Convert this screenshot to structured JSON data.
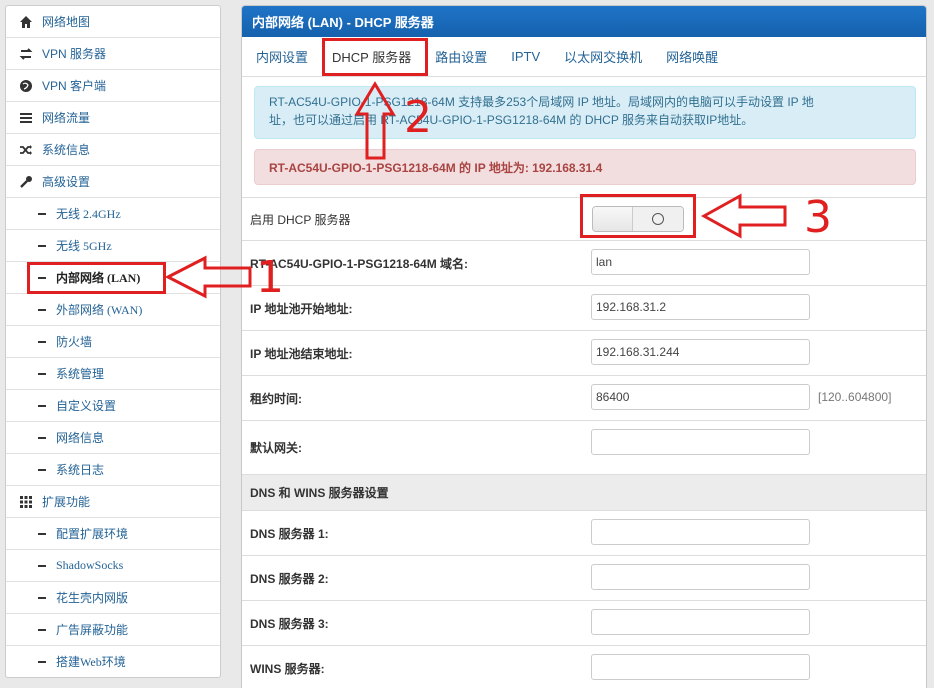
{
  "sidebar": {
    "items": [
      {
        "label": "网络地图",
        "icon": "home-icon",
        "type": "top"
      },
      {
        "label": "VPN 服务器",
        "icon": "exchange-icon",
        "type": "top"
      },
      {
        "label": "VPN 客户端",
        "icon": "globe-icon",
        "type": "top"
      },
      {
        "label": "网络流量",
        "icon": "list-icon",
        "type": "top"
      },
      {
        "label": "系统信息",
        "icon": "random-icon",
        "type": "top"
      },
      {
        "label": "高级设置",
        "icon": "wrench-icon",
        "type": "top"
      },
      {
        "label": "无线 2.4GHz",
        "type": "sub"
      },
      {
        "label": "无线 5GHz",
        "type": "sub"
      },
      {
        "label": "内部网络 (LAN)",
        "type": "sub",
        "active": true
      },
      {
        "label": "外部网络 (WAN)",
        "type": "sub"
      },
      {
        "label": "防火墙",
        "type": "sub"
      },
      {
        "label": "系统管理",
        "type": "sub"
      },
      {
        "label": "自定义设置",
        "type": "sub"
      },
      {
        "label": "网络信息",
        "type": "sub"
      },
      {
        "label": "系统日志",
        "type": "sub"
      },
      {
        "label": "扩展功能",
        "icon": "grid-icon",
        "type": "top"
      },
      {
        "label": "配置扩展环境",
        "type": "sub"
      },
      {
        "label": "ShadowSocks",
        "type": "sub"
      },
      {
        "label": "花生壳内网版",
        "type": "sub"
      },
      {
        "label": "广告屏蔽功能",
        "type": "sub"
      },
      {
        "label": "搭建Web环境",
        "type": "sub"
      }
    ]
  },
  "panel": {
    "title": "内部网络 (LAN) - DHCP 服务器",
    "tabs": [
      "内网设置",
      "DHCP 服务器",
      "路由设置",
      "IPTV",
      "以太网交换机",
      "网络唤醒"
    ],
    "active_tab": 1,
    "info_line1": "RT-AC54U-GPIO-1-PSG1218-64M 支持最多253个局域网 IP 地址。局域网内的电脑可以手动设置 IP 地",
    "info_line2": "址，也可以通过启用 RT-AC54U-GPIO-1-PSG1218-64M 的 DHCP 服务来自动获取IP地址。",
    "danger": "RT-AC54U-GPIO-1-PSG1218-64M 的 IP 地址为: 192.168.31.4"
  },
  "form": {
    "dhcp_enable_label": "启用 DHCP 服务器",
    "dhcp_enabled": false,
    "domain_label": "RT-AC54U-GPIO-1-PSG1218-64M 域名:",
    "domain_value": "lan",
    "pool_start_label": "IP 地址池开始地址:",
    "pool_start_value": "192.168.31.2",
    "pool_end_label": "IP 地址池结束地址:",
    "pool_end_value": "192.168.31.244",
    "lease_label": "租约时间:",
    "lease_value": "86400",
    "lease_hint": "[120..604800]",
    "gateway_label": "默认网关:",
    "gateway_value": "",
    "dns_section": "DNS 和 WINS 服务器设置",
    "dns1_label": "DNS 服务器 1:",
    "dns2_label": "DNS 服务器 2:",
    "dns3_label": "DNS 服务器 3:",
    "wins_label": "WINS 服务器:"
  },
  "annotations": {
    "n1": "1",
    "n2": "2",
    "n3": "3",
    "color": "#e02020"
  },
  "colors": {
    "header_blue": "#1a6bbf",
    "link": "#246396",
    "info_bg": "#d9edf7",
    "danger_bg": "#f2dede"
  }
}
